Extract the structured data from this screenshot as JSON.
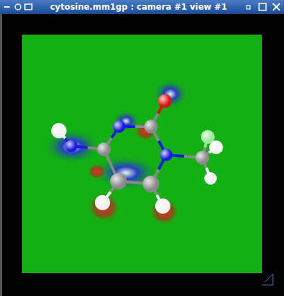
{
  "window": {
    "title": "cytosine.mm1gp : camera #1 view #1"
  },
  "molecule": {
    "atoms": [
      {
        "color": "#e01010"
      },
      {
        "color": "#8a8a8a"
      },
      {
        "color": "#1a1ae0"
      },
      {
        "color": "#8a8a8a"
      },
      {
        "color": "#1a1ae0"
      },
      {
        "color": "#f2f2f2"
      },
      {
        "color": "#1a1ae0"
      },
      {
        "color": "#8a8a8a"
      },
      {
        "color": "#9be89b"
      },
      {
        "color": "#f2f2f2"
      },
      {
        "color": "#f2f2f2"
      },
      {
        "color": "#8a8a8a"
      },
      {
        "color": "#f2f2f2"
      },
      {
        "color": "#8a8a8a"
      },
      {
        "color": "#f2f2f2"
      }
    ]
  }
}
